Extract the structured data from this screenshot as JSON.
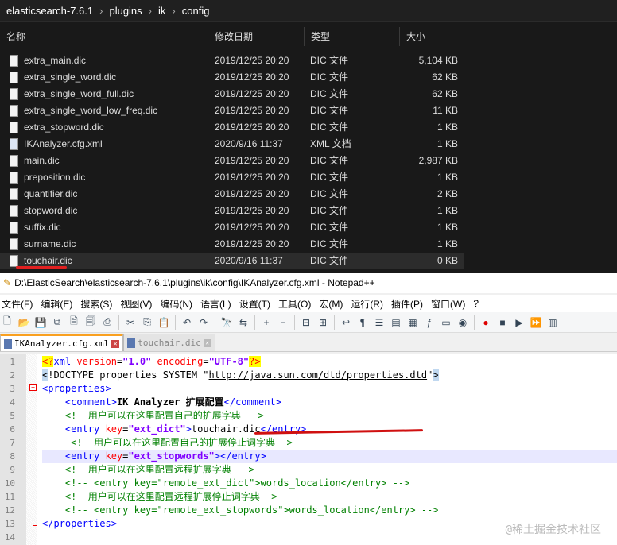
{
  "explorer": {
    "breadcrumb": [
      "elasticsearch-7.6.1",
      "plugins",
      "ik",
      "config"
    ],
    "columns": [
      "名称",
      "修改日期",
      "类型",
      "大小"
    ],
    "files": [
      {
        "name": "extra_main.dic",
        "date": "2019/12/25 20:20",
        "type": "DIC 文件",
        "size": "5,104 KB"
      },
      {
        "name": "extra_single_word.dic",
        "date": "2019/12/25 20:20",
        "type": "DIC 文件",
        "size": "62 KB"
      },
      {
        "name": "extra_single_word_full.dic",
        "date": "2019/12/25 20:20",
        "type": "DIC 文件",
        "size": "62 KB"
      },
      {
        "name": "extra_single_word_low_freq.dic",
        "date": "2019/12/25 20:20",
        "type": "DIC 文件",
        "size": "11 KB"
      },
      {
        "name": "extra_stopword.dic",
        "date": "2019/12/25 20:20",
        "type": "DIC 文件",
        "size": "1 KB"
      },
      {
        "name": "IKAnalyzer.cfg.xml",
        "date": "2020/9/16 11:37",
        "type": "XML 文档",
        "size": "1 KB"
      },
      {
        "name": "main.dic",
        "date": "2019/12/25 20:20",
        "type": "DIC 文件",
        "size": "2,987 KB"
      },
      {
        "name": "preposition.dic",
        "date": "2019/12/25 20:20",
        "type": "DIC 文件",
        "size": "1 KB"
      },
      {
        "name": "quantifier.dic",
        "date": "2019/12/25 20:20",
        "type": "DIC 文件",
        "size": "2 KB"
      },
      {
        "name": "stopword.dic",
        "date": "2019/12/25 20:20",
        "type": "DIC 文件",
        "size": "1 KB"
      },
      {
        "name": "suffix.dic",
        "date": "2019/12/25 20:20",
        "type": "DIC 文件",
        "size": "1 KB"
      },
      {
        "name": "surname.dic",
        "date": "2019/12/25 20:20",
        "type": "DIC 文件",
        "size": "1 KB"
      },
      {
        "name": "touchair.dic",
        "date": "2020/9/16 11:37",
        "type": "DIC 文件",
        "size": "0 KB"
      }
    ]
  },
  "npp": {
    "title": "D:\\ElasticSearch\\elasticsearch-7.6.1\\plugins\\ik\\config\\IKAnalyzer.cfg.xml - Notepad++",
    "menu": [
      "文件(F)",
      "编辑(E)",
      "搜索(S)",
      "视图(V)",
      "编码(N)",
      "语言(L)",
      "设置(T)",
      "工具(O)",
      "宏(M)",
      "运行(R)",
      "插件(P)",
      "窗口(W)",
      "?"
    ],
    "tabs": [
      "IKAnalyzer.cfg.xml",
      "touchair.dic"
    ],
    "lines": [
      [
        [
          "<?",
          "t-pi"
        ],
        [
          "xml ",
          "t-tag"
        ],
        [
          "version",
          "t-attr"
        ],
        [
          "=",
          "t-txt"
        ],
        [
          "\"1.0\"",
          "t-val"
        ],
        [
          " ",
          "t-txt"
        ],
        [
          "encoding",
          "t-attr"
        ],
        [
          "=",
          "t-txt"
        ],
        [
          "\"UTF-8\"",
          "t-val"
        ],
        [
          "?>",
          "t-pi"
        ]
      ],
      [
        [
          "<",
          "t-hl"
        ],
        [
          "!DOCTYPE properties SYSTEM \"",
          "t-txt"
        ],
        [
          "http://java.sun.com/dtd/properties.dtd",
          "t-url"
        ],
        [
          "\"",
          "t-txt"
        ],
        [
          ">",
          "t-hl"
        ]
      ],
      [
        [
          "<properties>",
          "t-tag"
        ]
      ],
      [
        [
          "    <comment>",
          "t-tag"
        ],
        [
          "IK Analyzer 扩展配置",
          "t-bold"
        ],
        [
          "</comment>",
          "t-tag"
        ]
      ],
      [
        [
          "    <!--用户可以在这里配置自己的扩展字典 -->",
          "t-com"
        ]
      ],
      [
        [
          "    <entry ",
          "t-tag"
        ],
        [
          "key",
          "t-attr"
        ],
        [
          "=",
          "t-txt"
        ],
        [
          "\"ext_dict\"",
          "t-val"
        ],
        [
          ">",
          "t-tag"
        ],
        [
          "touchair.dic",
          "t-txt"
        ],
        [
          "</entry>",
          "t-tag"
        ]
      ],
      [
        [
          "     <!--用户可以在这里配置自己的扩展停止词字典-->",
          "t-com"
        ]
      ],
      [
        [
          "    <entry ",
          "t-tag"
        ],
        [
          "key",
          "t-attr"
        ],
        [
          "=",
          "t-txt"
        ],
        [
          "\"ext_stopwords\"",
          "t-val"
        ],
        [
          "></entry>",
          "t-tag"
        ]
      ],
      [
        [
          "    <!--用户可以在这里配置远程扩展字典 -->",
          "t-com"
        ]
      ],
      [
        [
          "    <!-- <entry key=\"remote_ext_dict\">words_location</entry> -->",
          "t-com"
        ]
      ],
      [
        [
          "    <!--用户可以在这里配置远程扩展停止词字典-->",
          "t-com"
        ]
      ],
      [
        [
          "    <!-- <entry key=\"remote_ext_stopwords\">words_location</entry> -->",
          "t-com"
        ]
      ],
      [
        [
          "</properties>",
          "t-tag"
        ]
      ],
      []
    ],
    "watermark": "@稀土掘金技术社区"
  }
}
